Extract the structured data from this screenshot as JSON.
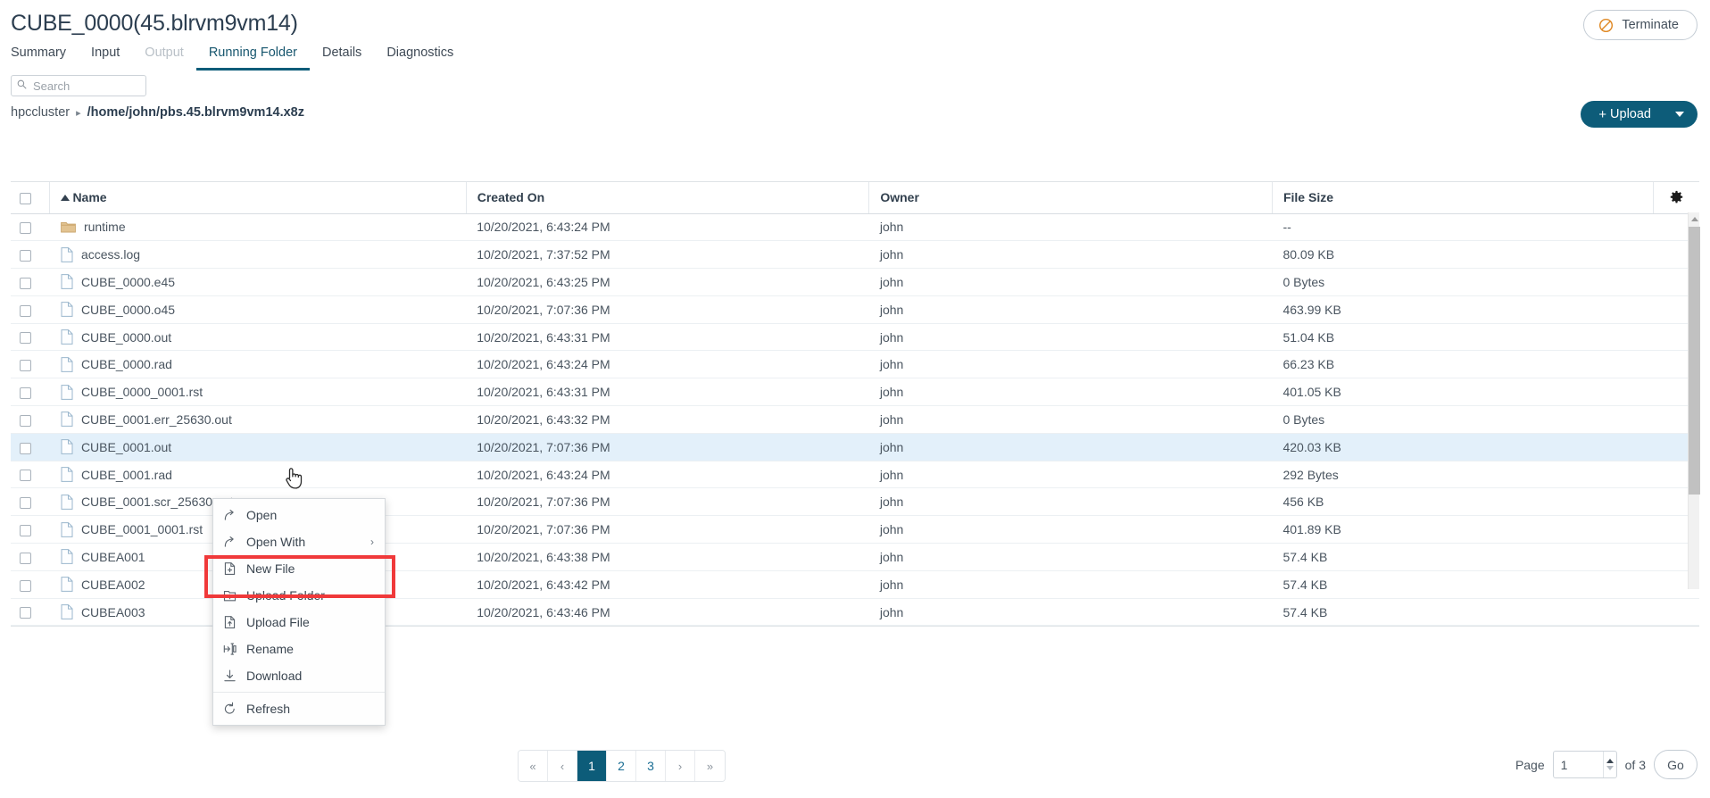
{
  "header": {
    "title": "CUBE_0000(45.blrvm9vm14)",
    "terminate_label": "Terminate"
  },
  "tabs": [
    {
      "label": "Summary",
      "state": "normal"
    },
    {
      "label": "Input",
      "state": "normal"
    },
    {
      "label": "Output",
      "state": "disabled"
    },
    {
      "label": "Running Folder",
      "state": "active"
    },
    {
      "label": "Details",
      "state": "normal"
    },
    {
      "label": "Diagnostics",
      "state": "normal"
    }
  ],
  "search": {
    "placeholder": "Search",
    "value": ""
  },
  "breadcrumb": {
    "root": "hpccluster",
    "separator": "▸",
    "path": "/home/john/pbs.45.blrvm9vm14.x8z"
  },
  "upload": {
    "label": "Upload",
    "plus": "+"
  },
  "table": {
    "columns": [
      "Name",
      "Created On",
      "Owner",
      "File Size"
    ],
    "sort_column": "Name",
    "sort_direction": "asc",
    "rows": [
      {
        "name": "runtime",
        "icon": "folder",
        "created": "10/20/2021, 6:43:24 PM",
        "owner": "john",
        "size": "--",
        "selected": false
      },
      {
        "name": "access.log",
        "icon": "file",
        "created": "10/20/2021, 7:37:52 PM",
        "owner": "john",
        "size": "80.09 KB",
        "selected": false
      },
      {
        "name": "CUBE_0000.e45",
        "icon": "file",
        "created": "10/20/2021, 6:43:25 PM",
        "owner": "john",
        "size": "0 Bytes",
        "selected": false
      },
      {
        "name": "CUBE_0000.o45",
        "icon": "file",
        "created": "10/20/2021, 7:07:36 PM",
        "owner": "john",
        "size": "463.99 KB",
        "selected": false
      },
      {
        "name": "CUBE_0000.out",
        "icon": "file",
        "created": "10/20/2021, 6:43:31 PM",
        "owner": "john",
        "size": "51.04 KB",
        "selected": false
      },
      {
        "name": "CUBE_0000.rad",
        "icon": "file",
        "created": "10/20/2021, 6:43:24 PM",
        "owner": "john",
        "size": "66.23 KB",
        "selected": false
      },
      {
        "name": "CUBE_0000_0001.rst",
        "icon": "file",
        "created": "10/20/2021, 6:43:31 PM",
        "owner": "john",
        "size": "401.05 KB",
        "selected": false
      },
      {
        "name": "CUBE_0001.err_25630.out",
        "icon": "file",
        "created": "10/20/2021, 6:43:32 PM",
        "owner": "john",
        "size": "0 Bytes",
        "selected": false
      },
      {
        "name": "CUBE_0001.out",
        "icon": "file",
        "created": "10/20/2021, 7:07:36 PM",
        "owner": "john",
        "size": "420.03 KB",
        "selected": true
      },
      {
        "name": "CUBE_0001.rad",
        "icon": "file",
        "created": "10/20/2021, 6:43:24 PM",
        "owner": "john",
        "size": "292 Bytes",
        "selected": false
      },
      {
        "name": "CUBE_0001.scr_25630.out",
        "icon": "file",
        "created": "10/20/2021, 7:07:36 PM",
        "owner": "john",
        "size": "456 KB",
        "selected": false
      },
      {
        "name": "CUBE_0001_0001.rst",
        "icon": "file",
        "created": "10/20/2021, 7:07:36 PM",
        "owner": "john",
        "size": "401.89 KB",
        "selected": false
      },
      {
        "name": "CUBEA001",
        "icon": "file",
        "created": "10/20/2021, 6:43:38 PM",
        "owner": "john",
        "size": "57.4 KB",
        "selected": false
      },
      {
        "name": "CUBEA002",
        "icon": "file",
        "created": "10/20/2021, 6:43:42 PM",
        "owner": "john",
        "size": "57.4 KB",
        "selected": false
      },
      {
        "name": "CUBEA003",
        "icon": "file",
        "created": "10/20/2021, 6:43:46 PM",
        "owner": "john",
        "size": "57.4 KB",
        "selected": false
      }
    ]
  },
  "context_menu": {
    "items": [
      {
        "label": "Open",
        "icon": "open-arrow-icon",
        "submenu": false
      },
      {
        "label": "Open With",
        "icon": "open-arrow-icon",
        "submenu": true
      },
      {
        "label": "New File",
        "icon": "new-file-icon",
        "submenu": false
      },
      {
        "label": "Upload Folder",
        "icon": "upload-folder-icon",
        "submenu": false
      },
      {
        "label": "Upload File",
        "icon": "upload-file-icon",
        "submenu": false
      },
      {
        "label": "Rename",
        "icon": "rename-icon",
        "submenu": false
      },
      {
        "label": "Download",
        "icon": "download-icon",
        "submenu": false
      },
      {
        "label": "Refresh",
        "icon": "refresh-icon",
        "submenu": false
      }
    ],
    "submenu_arrow": "›"
  },
  "pagination": {
    "first": "«",
    "prev": "‹",
    "pages": [
      "1",
      "2",
      "3"
    ],
    "current_page": "1",
    "next": "›",
    "last": "»",
    "page_label": "Page",
    "page_value": "1",
    "of_label": "of 3",
    "go_label": "Go"
  },
  "colors": {
    "accent": "#0d5c79",
    "link": "#1b6e94",
    "terminate_icon": "#e08a27",
    "annotation": "#f0393a",
    "selected_row": "#e3f0fa",
    "folder": "#e2c391"
  }
}
